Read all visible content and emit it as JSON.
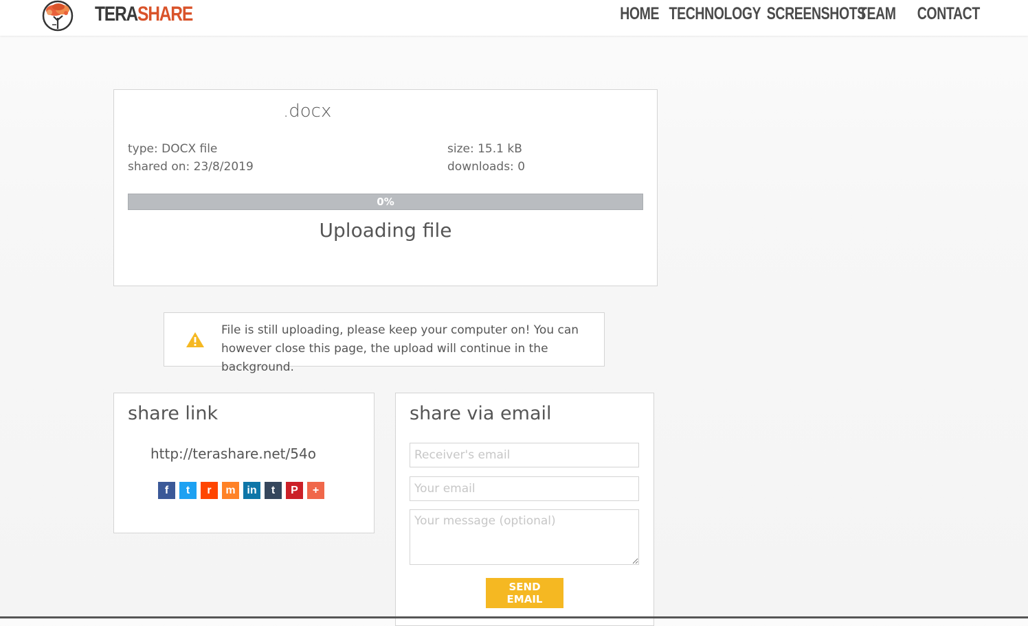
{
  "header": {
    "logo": {
      "tera": "TERA",
      "share": "SHARE"
    },
    "nav": [
      {
        "label": "HOME"
      },
      {
        "label": "TECHNOLOGY"
      },
      {
        "label": "SCREENSHOTS"
      },
      {
        "label": "TEAM"
      },
      {
        "label": "CONTACT"
      }
    ]
  },
  "file": {
    "name": ".docx",
    "type": "type: DOCX file",
    "shared_on": "shared on: 23/8/2019",
    "size": "size: 15.1 kB",
    "downloads": "downloads: 0",
    "progress_percent": 0,
    "progress_label": "0%",
    "status": "Uploading file"
  },
  "warning": {
    "icon": "warning-triangle-icon",
    "text": "File is still uploading, please keep your computer on! You can however close this page, the upload will continue in the background."
  },
  "share_link": {
    "title": "share link",
    "url": "http://terashare.net/54o",
    "social": [
      {
        "name": "facebook-icon",
        "glyph": "f",
        "color": "#3b5998"
      },
      {
        "name": "twitter-icon",
        "glyph": "t",
        "color": "#1da1f2"
      },
      {
        "name": "reddit-icon",
        "glyph": "r",
        "color": "#ff4500"
      },
      {
        "name": "mix-icon",
        "glyph": "m",
        "color": "#ff8226"
      },
      {
        "name": "linkedin-icon",
        "glyph": "in",
        "color": "#0e76a8"
      },
      {
        "name": "tumblr-icon",
        "glyph": "t",
        "color": "#35465c"
      },
      {
        "name": "pinterest-icon",
        "glyph": "P",
        "color": "#cb2027"
      },
      {
        "name": "more-share-icon",
        "glyph": "+",
        "color": "#f0674a"
      }
    ]
  },
  "share_email": {
    "title": "share via email",
    "receiver_placeholder": "Receiver's email",
    "your_email_placeholder": "Your email",
    "message_placeholder": "Your message (optional)",
    "send_label": "SEND EMAIL"
  },
  "colors": {
    "accent": "#f5b822",
    "brand": "#d9532a"
  }
}
